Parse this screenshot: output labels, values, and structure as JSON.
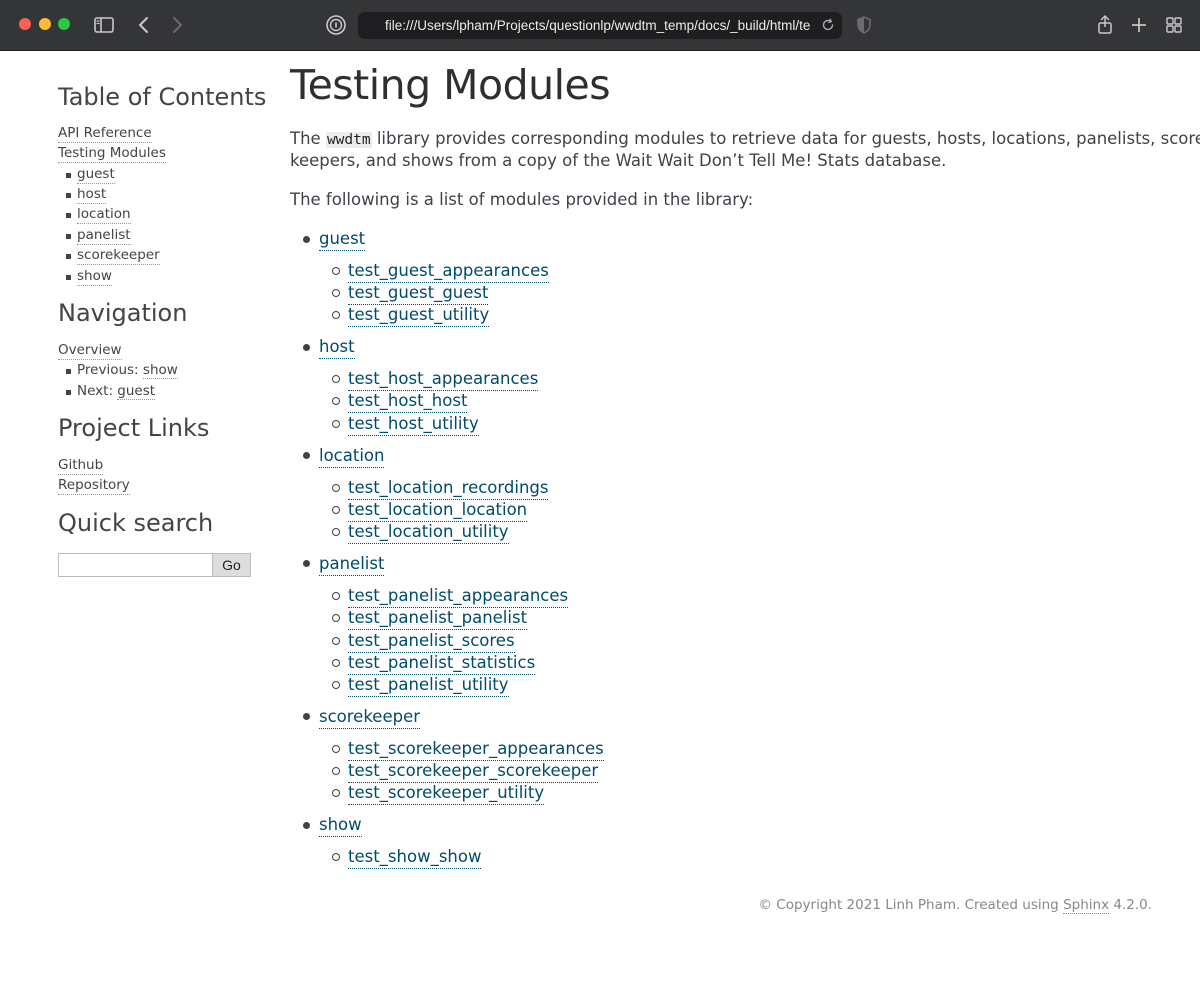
{
  "browser": {
    "url": "file:///Users/lpham/Projects/questionlp/wwdtm_temp/docs/_build/html/te",
    "icons": [
      "sidebar-icon",
      "back-icon",
      "forward-icon",
      "privacy-report-icon",
      "reload-icon",
      "shield-icon",
      "share-icon",
      "new-tab-icon",
      "tab-overview-icon"
    ]
  },
  "sidebar": {
    "toc_heading": "Table of Contents",
    "toc_links": [
      "API Reference",
      "Testing Modules"
    ],
    "toc_items": [
      "guest",
      "host",
      "location",
      "panelist",
      "scorekeeper",
      "show"
    ],
    "nav_heading": "Navigation",
    "nav_overview": "Overview",
    "nav_prev_label": "Previous:",
    "nav_prev_link": "show",
    "nav_next_label": "Next:",
    "nav_next_link": "guest",
    "links_heading": "Project Links",
    "project_links": [
      "Github",
      "Repository"
    ],
    "search_heading": "Quick search",
    "search_value": "",
    "search_button": "Go"
  },
  "main": {
    "title": "Testing Modules",
    "intro_prefix": "The ",
    "intro_code": "wwdtm",
    "intro_rest": " library provides corresponding modules to retrieve data for guests, hosts, locations, panelists, score-",
    "intro_line2": "keepers, and shows from a copy of the Wait Wait Don’t Tell Me! Stats database.",
    "list_intro": "The following is a list of modules provided in the library:",
    "modules": [
      {
        "name": "guest",
        "tests": [
          "test_guest_appearances",
          "test_guest_guest",
          "test_guest_utility"
        ]
      },
      {
        "name": "host",
        "tests": [
          "test_host_appearances",
          "test_host_host",
          "test_host_utility"
        ]
      },
      {
        "name": "location",
        "tests": [
          "test_location_recordings",
          "test_location_location",
          "test_location_utility"
        ]
      },
      {
        "name": "panelist",
        "tests": [
          "test_panelist_appearances",
          "test_panelist_panelist",
          "test_panelist_scores",
          "test_panelist_statistics",
          "test_panelist_utility"
        ]
      },
      {
        "name": "scorekeeper",
        "tests": [
          "test_scorekeeper_appearances",
          "test_scorekeeper_scorekeeper",
          "test_scorekeeper_utility"
        ]
      },
      {
        "name": "show",
        "tests": [
          "test_show_show"
        ]
      }
    ]
  },
  "footer": {
    "prefix": "© Copyright 2021 Linh Pham. Created using ",
    "link": "Sphinx",
    "suffix": " 4.2.0."
  }
}
